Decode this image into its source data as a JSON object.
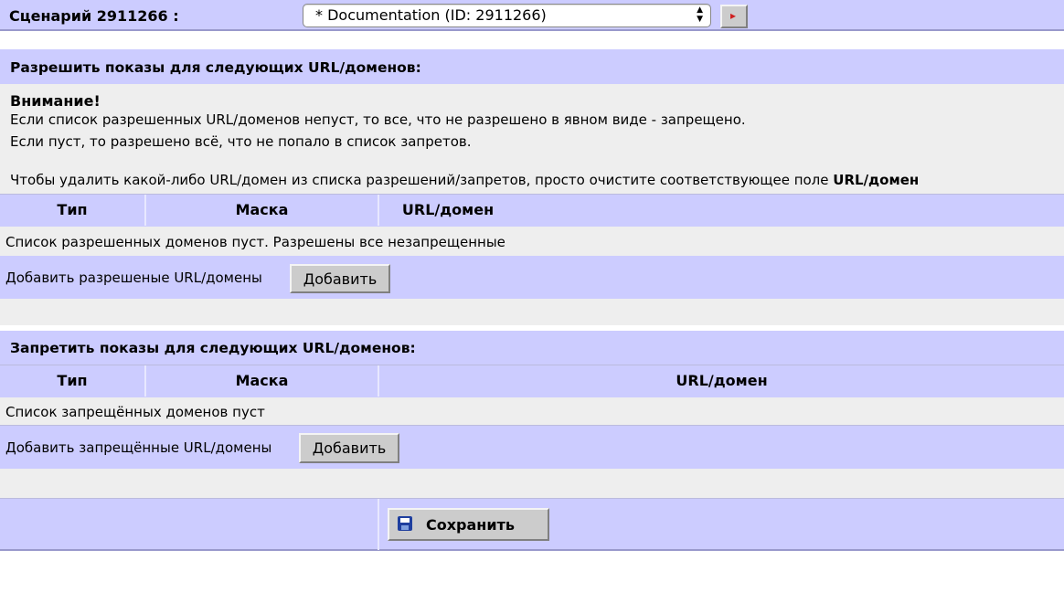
{
  "scenario": {
    "label": "Сценарий 2911266 :",
    "selected": "* Documentation (ID: 2911266)"
  },
  "allow": {
    "title": "Разрешить показы для следующих URL/доменов:",
    "warning_title": "Внимание!",
    "warning_line1": "Если список разрешенных URL/доменов непуст, то все, что не разрешено в явном виде - запрещено.",
    "warning_line2": "Если пуст, то разрешено всё, что не попало в список запретов.",
    "remove_hint": "Чтобы удалить какой-либо URL/домен из списка разрешений/запретов, просто очистите соответствующее поле",
    "remove_hint_bold": "URL/домен",
    "columns": [
      "Тип",
      "Маска",
      "URL/домен"
    ],
    "empty_text": "Список разрешенных доменов пуст. Разрешены все незапрещенные",
    "add_label": "Добавить разрешеные URL/домены",
    "add_button": "Добавить"
  },
  "deny": {
    "title": "Запретить показы для следующих URL/доменов:",
    "columns": [
      "Тип",
      "Маска",
      "URL/домен"
    ],
    "empty_text": "Список запрещённых доменов пуст",
    "add_label": "Добавить запрещённые URL/домены",
    "add_button": "Добавить"
  },
  "save_button": "Сохранить",
  "colors": {
    "lavender": "#ccccff",
    "gray": "#eeeeee",
    "border": "#9999cc"
  }
}
